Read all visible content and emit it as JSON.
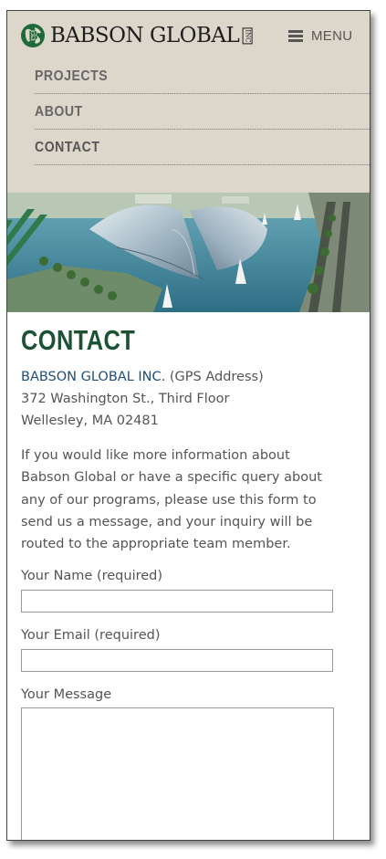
{
  "header": {
    "logo_text": "BABSON GLOBAL",
    "logo_suffix": "INC",
    "menu_label": "MENU"
  },
  "nav": {
    "items": [
      {
        "label": "PROJECTS"
      },
      {
        "label": "ABOUT"
      },
      {
        "label": "CONTACT"
      }
    ]
  },
  "main": {
    "title": "CONTACT",
    "address": {
      "company": "BABSON GLOBAL INC.",
      "gps_note": "(GPS Address)",
      "line1": "372 Washington St., Third Floor",
      "line2": "Wellesley, MA 02481"
    },
    "intro": "If you would like more information about Babson Global or have a specific query about any of our programs, please use this form to send us a message, and your inquiry will be routed to the appropriate team member."
  },
  "form": {
    "name_label": "Your Name (required)",
    "name_value": "",
    "email_label": "Your Email (required)",
    "email_value": "",
    "message_label": "Your Message",
    "message_value": ""
  },
  "colors": {
    "header_bg": "#dcd7ca",
    "title_green": "#1c5234",
    "link_blue": "#1f4e79",
    "logo_green": "#1e6b3a"
  },
  "icons": {
    "logo": "babson-globe-logo-icon",
    "menu": "hamburger-icon"
  }
}
